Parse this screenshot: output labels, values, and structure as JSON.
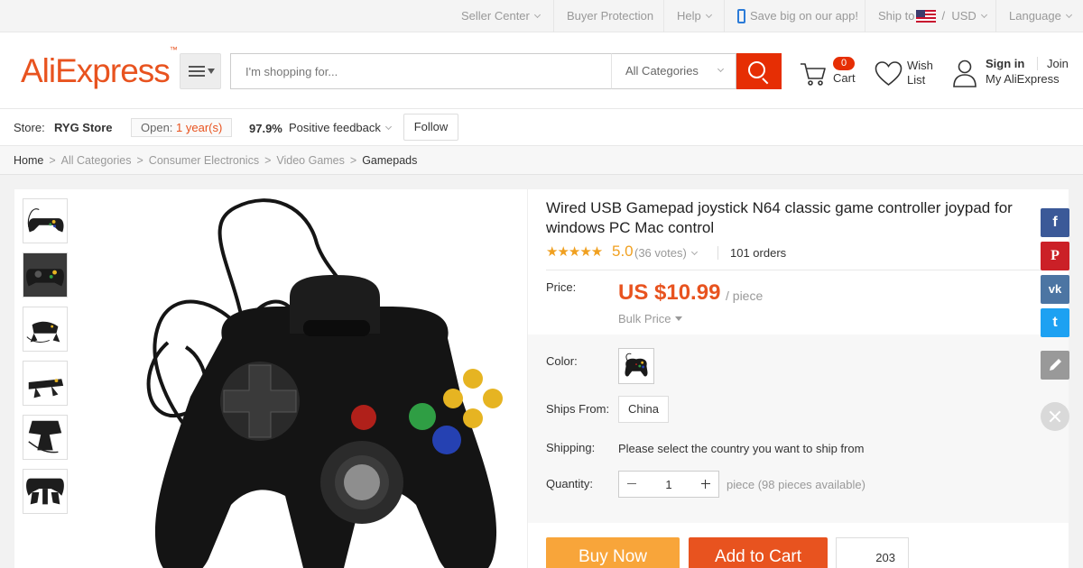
{
  "topbar": {
    "seller_center": "Seller Center",
    "buyer_protection": "Buyer Protection",
    "help": "Help",
    "app_promo": "Save big on our app!",
    "ship_to": "Ship to",
    "currency": "USD",
    "language": "Language"
  },
  "header": {
    "logo": "AliExpress",
    "search_placeholder": "I'm shopping for...",
    "category": "All Categories",
    "cart_count": "0",
    "cart_label": "Cart",
    "wish_label_1": "Wish",
    "wish_label_2": "List",
    "sign_in": "Sign in",
    "join": "Join",
    "my_account": "My AliExpress"
  },
  "store": {
    "label": "Store:",
    "name": "RYG Store",
    "open_prefix": "Open:",
    "open_years": "1 year(s)",
    "feedback_pct": "97.9%",
    "feedback_label": "Positive feedback",
    "follow": "Follow"
  },
  "breadcrumb": [
    "Home",
    "All Categories",
    "Consumer Electronics",
    "Video Games",
    "Gamepads"
  ],
  "product": {
    "title": "Wired USB Gamepad joystick N64 classic game controller joypad for windows PC Mac control",
    "stars": "★★★★★",
    "rating": "5.0",
    "votes": "(36 votes)",
    "orders": "101 orders",
    "price_label": "Price:",
    "price": "US $10.99",
    "price_unit": "/ piece",
    "bulk_price": "Bulk Price",
    "color_label": "Color:",
    "ships_from_label": "Ships From:",
    "ships_from": "China",
    "shipping_label": "Shipping:",
    "shipping_text": "Please select the country you want to ship from",
    "quantity_label": "Quantity:",
    "quantity": "1",
    "availability": "piece (98 pieces available)",
    "buy_now": "Buy Now",
    "add_to_cart": "Add to Cart",
    "wish_count": "203"
  },
  "social": {
    "facebook": "f",
    "pinterest": "P",
    "vk": "vk",
    "twitter": "t",
    "colors": {
      "facebook": "#3b5998",
      "pinterest": "#cb2027",
      "vk": "#4c75a3",
      "twitter": "#1da1f2",
      "edit": "#999999"
    }
  },
  "colors": {
    "brand": "#e8531f",
    "search_button": "#e62e04",
    "buy_now": "#f8a53a",
    "star": "#f0a020"
  }
}
